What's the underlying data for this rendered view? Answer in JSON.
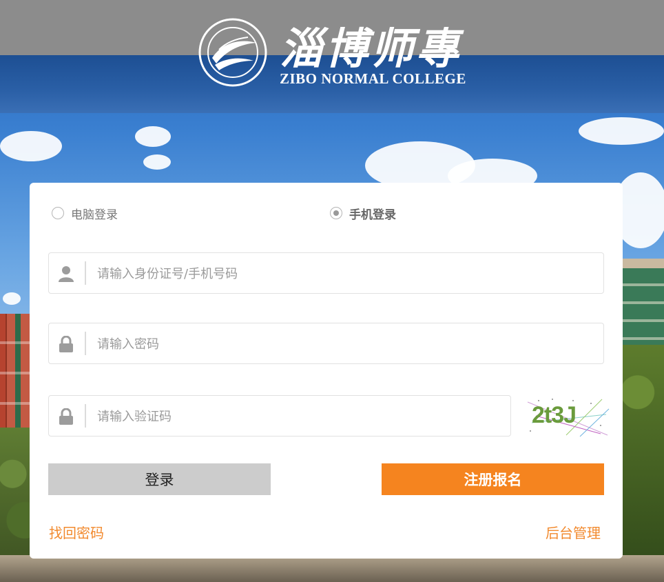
{
  "header": {
    "logo_cn": "淄博师專",
    "logo_en": "ZIBO NORMAL COLLEGE"
  },
  "login_mode": {
    "options": [
      {
        "label": "电脑登录",
        "selected": false
      },
      {
        "label": "手机登录",
        "selected": true
      }
    ]
  },
  "form": {
    "id_placeholder": "请输入身份证号/手机号码",
    "password_placeholder": "请输入密码",
    "captcha_placeholder": "请输入验证码",
    "captcha_text": "2t3J"
  },
  "buttons": {
    "login_label": "登录",
    "register_label": "注册报名"
  },
  "links": {
    "forgot_password": "找回密码",
    "admin": "后台管理"
  },
  "colors": {
    "accent_orange": "#f5841f",
    "link_orange": "#f28a2e",
    "header_gray": "#8c8c8c",
    "header_blue": "#2a5fa6",
    "login_gray": "#cccccc"
  }
}
